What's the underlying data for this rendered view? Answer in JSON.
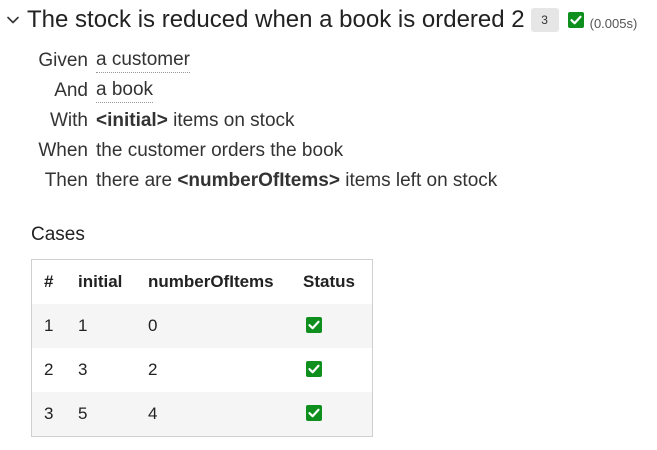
{
  "scenario": {
    "title": "The stock is reduced when a book is ordered 2",
    "case_count": "3",
    "duration": "(0.005s)",
    "status": "success",
    "status_color": "#0f8f1e"
  },
  "steps": [
    {
      "keyword": "Given",
      "text": "a customer"
    },
    {
      "keyword": "And",
      "text": "a book"
    },
    {
      "keyword": "With",
      "param": "<initial>",
      "text": "items on stock"
    },
    {
      "keyword": "When",
      "text": "the customer orders the book"
    },
    {
      "keyword": "Then",
      "prefix": "there are",
      "param": "<numberOfItems>",
      "text": "items left on stock"
    }
  ],
  "cases": {
    "title": "Cases",
    "headers": [
      "#",
      "initial",
      "numberOfItems",
      "Status"
    ],
    "rows": [
      {
        "num": "1",
        "initial": "1",
        "numberOfItems": "0",
        "status": "passed"
      },
      {
        "num": "2",
        "initial": "3",
        "numberOfItems": "2",
        "status": "passed"
      },
      {
        "num": "3",
        "initial": "5",
        "numberOfItems": "4",
        "status": "passed"
      }
    ]
  },
  "icons": {
    "collapse": "chevron-down-icon",
    "status": "check-square-icon"
  }
}
